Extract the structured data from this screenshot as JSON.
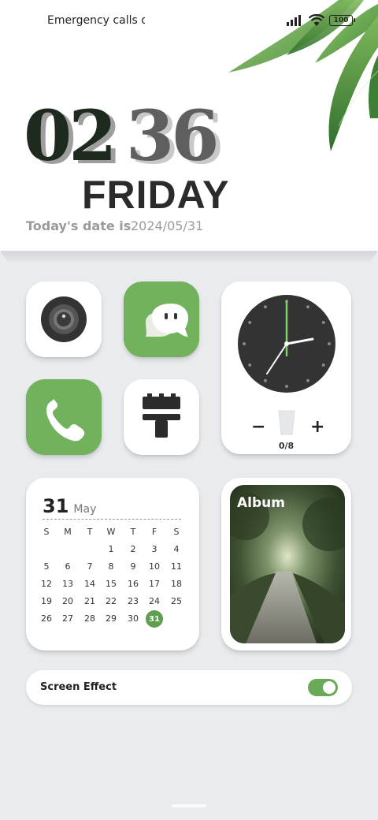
{
  "status_bar": {
    "carrier_text": "Emergency calls o",
    "battery": "100",
    "signal_icon": "signal-icon",
    "wifi_icon": "wifi-icon"
  },
  "clock": {
    "hour": "02",
    "minute": "36",
    "weekday": "FRIDAY",
    "date_label": "Today's date is",
    "date_value": "2024/05/31"
  },
  "apps": [
    {
      "name": "camera",
      "icon": "camera-icon",
      "tile": "white"
    },
    {
      "name": "messages",
      "icon": "chat-icon",
      "tile": "green"
    },
    {
      "name": "phone",
      "icon": "phone-icon",
      "tile": "green"
    },
    {
      "name": "cleaner",
      "icon": "broom-icon",
      "tile": "white"
    }
  ],
  "clock_widget": {
    "minus": "−",
    "plus": "+",
    "water_count": "0/8",
    "hand_color": "#7dd16a"
  },
  "calendar": {
    "day": "31",
    "month": "May",
    "weekdays": [
      "S",
      "M",
      "T",
      "W",
      "T",
      "F",
      "S"
    ],
    "rows": [
      [
        "",
        "",
        "",
        "1",
        "2",
        "3",
        "4"
      ],
      [
        "5",
        "6",
        "7",
        "8",
        "9",
        "10",
        "11"
      ],
      [
        "12",
        "13",
        "14",
        "15",
        "16",
        "17",
        "18"
      ],
      [
        "19",
        "20",
        "21",
        "22",
        "23",
        "24",
        "25"
      ],
      [
        "26",
        "27",
        "28",
        "29",
        "30",
        "31",
        ""
      ]
    ],
    "today": "31"
  },
  "album": {
    "label": "Album"
  },
  "screen_effect": {
    "label": "Screen Effect",
    "enabled": true
  },
  "colors": {
    "accent_green": "#72b25c",
    "background": "#e9ebee"
  }
}
